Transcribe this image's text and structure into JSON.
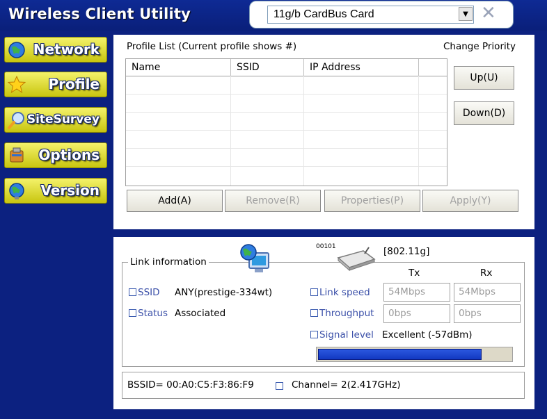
{
  "app": {
    "title": "Wireless Client Utility",
    "device_select": "11g/b CardBus Card",
    "dropdown_arrow": "▼",
    "close_glyph": "✕"
  },
  "nav": [
    {
      "label": "Network",
      "icon": "globe-icon"
    },
    {
      "label": "Profile",
      "icon": "star-icon"
    },
    {
      "label": "SiteSurvey",
      "icon": "magnifier-icon"
    },
    {
      "label": "Options",
      "icon": "tools-icon"
    },
    {
      "label": "Version",
      "icon": "globe-person-icon"
    }
  ],
  "profile": {
    "list_label": "Profile List (Current profile shows #)",
    "priority_label": "Change Priority",
    "columns": [
      "Name",
      "SSID",
      "IP Address",
      ""
    ],
    "rows": [],
    "up": "Up(U)",
    "down": "Down(D)",
    "add": "Add(A)",
    "remove": "Remove(R)",
    "properties": "Properties(P)",
    "apply": "Apply(Y)"
  },
  "link": {
    "group_label": "Link information",
    "standard": "[802.11g]",
    "device_code": "00101",
    "ssid_label": "SSID",
    "ssid_value": "ANY(prestige-334wt)",
    "status_label": "Status",
    "status_value": "Associated",
    "tx_header": "Tx",
    "rx_header": "Rx",
    "link_speed_label": "Link speed",
    "link_speed_tx": "54Mbps",
    "link_speed_rx": "54Mbps",
    "throughput_label": "Throughput",
    "throughput_tx": "0bps",
    "throughput_rx": "0bps",
    "signal_label": "Signal level",
    "signal_value": "Excellent (-57dBm)",
    "signal_fraction": 0.85,
    "bssid": "BSSID= 00:A0:C5:F3:86:F9",
    "channel": "Channel= 2(2.417GHz)"
  },
  "colors": {
    "background": "#0c2180",
    "nav_button": "#e6e33a",
    "signal_fill": "#1e46d8"
  }
}
